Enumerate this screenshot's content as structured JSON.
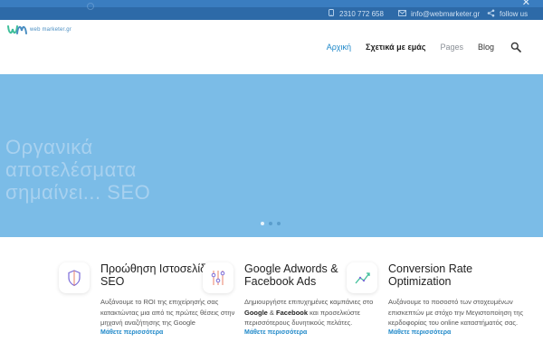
{
  "topbar": {
    "phone": "2310 772 658",
    "email": "info@webmarketer.gr",
    "follow": "follow us",
    "close": "✕",
    "icons": {
      "phone": "phone-icon",
      "email": "mail-icon",
      "share": "share-icon"
    }
  },
  "header": {
    "logo_text": "web marketer.gr",
    "nav": [
      "Αρχική",
      "Σχετικά με εμάς",
      "Pages",
      "Blog"
    ]
  },
  "hero": {
    "title": "Οργανικά αποτελέσματα σημαίνει... SEO",
    "slides": 3,
    "active_slide": 1
  },
  "features": [
    {
      "title": "Προώθηση Ιστοσελίδων SEO",
      "text": "Αυξάνουμε το ROI της επιχείρησής σας κατακτώντας μια από τις πρώτες θέσεις στην μηχανή αναζήτησης της Google",
      "more": "Μάθετε περισσότερα",
      "icon": "shield-icon",
      "color": "#7b6cd9"
    },
    {
      "title": "Google Adwords & Facebook Ads",
      "text_parts": [
        "Δημιουργήστε επιτυχημένες καμπάνιες στο ",
        "Google",
        " & ",
        "Facebook",
        " και προσελκύστε περισσότερους δυνητικούς πελάτες."
      ],
      "more": "Μάθετε περισσότερα",
      "icon": "sliders-icon",
      "color": "#e9806a"
    },
    {
      "title": "Conversion Rate Optimization",
      "text": "Αυξάνουμε το ποσοστό των στοχευμένων επισκεπτών με στόχο την Μεγιστοποίηση της κερδοφορίας του online καταστήματός σας.",
      "more": "Μάθετε περισσότερα",
      "icon": "trend-chart-icon",
      "color": "#3fbf9a"
    }
  ],
  "colors": {
    "accent": "#1e88c9",
    "topbar": "#2d6aa8",
    "hero": "#7bbce7"
  }
}
